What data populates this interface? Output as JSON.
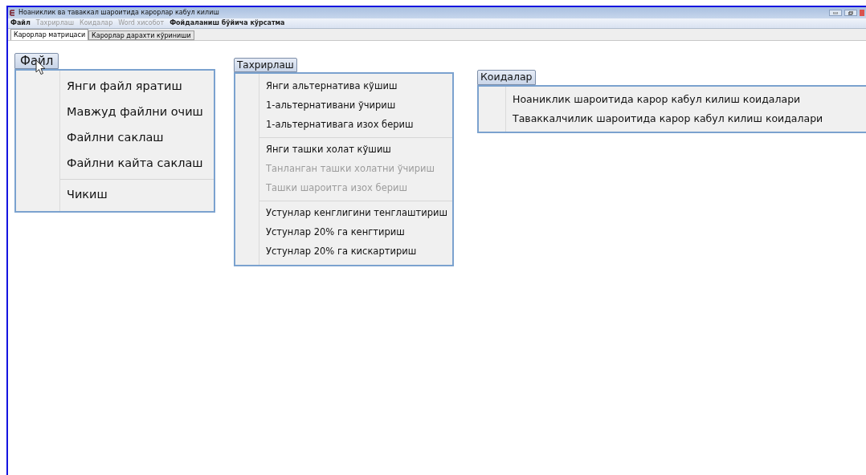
{
  "window": {
    "title": "Ноаниклик ва таваккал шароитида карорлар кабул килиш"
  },
  "menu_bar": [
    {
      "label": "Файл",
      "disabled": false
    },
    {
      "label": "Тахрирлаш",
      "disabled": true
    },
    {
      "label": "Коидалар",
      "disabled": true
    },
    {
      "label": "Word хисобот",
      "disabled": true
    },
    {
      "label": "Фойдаланиш бўйича кўрсатма",
      "disabled": false
    }
  ],
  "tabs": [
    {
      "label": "Карорлар матрицаси",
      "selected": true
    },
    {
      "label": "Карорлар дарахти кўриниши",
      "selected": false
    }
  ],
  "menus": [
    {
      "title": "Файл",
      "items": [
        {
          "kind": "item",
          "label": "Янги файл яратиш",
          "disabled": false
        },
        {
          "kind": "item",
          "label": "Мавжуд файлни очиш",
          "disabled": false
        },
        {
          "kind": "item",
          "label": "Файлни саклаш",
          "disabled": false
        },
        {
          "kind": "item",
          "label": "Файлни кайта саклаш",
          "disabled": false
        },
        {
          "kind": "separator"
        },
        {
          "kind": "item",
          "label": "Чикиш",
          "disabled": false
        }
      ]
    },
    {
      "title": "Тахрирлаш",
      "items": [
        {
          "kind": "item",
          "label": "Янги альтернатива кўшиш",
          "disabled": false
        },
        {
          "kind": "item",
          "label": "1-альтернативани ўчириш",
          "disabled": false
        },
        {
          "kind": "item",
          "label": "1-альтернативага  изох бериш",
          "disabled": false
        },
        {
          "kind": "separator"
        },
        {
          "kind": "item",
          "label": "Янги ташки холат кўшиш",
          "disabled": false
        },
        {
          "kind": "item",
          "label": "Танланган ташки холатни ўчириш",
          "disabled": true
        },
        {
          "kind": "item",
          "label": "Ташки шароитга изох бериш",
          "disabled": true
        },
        {
          "kind": "separator"
        },
        {
          "kind": "item",
          "label": "Устунлар кенглигини тенглаштириш",
          "disabled": false
        },
        {
          "kind": "item",
          "label": "Устунлар 20% га кенгтириш",
          "disabled": false
        },
        {
          "kind": "item",
          "label": "Устунлар 20% га  кискартириш",
          "disabled": false
        }
      ]
    },
    {
      "title": "Коидалар",
      "items": [
        {
          "kind": "item",
          "label": "Ноаниклик шароитида карор кабул килиш коидалари",
          "disabled": false
        },
        {
          "kind": "item",
          "label": "Таваккалчилик шароитида карор кабул килиш коидалари",
          "disabled": false
        }
      ]
    }
  ]
}
